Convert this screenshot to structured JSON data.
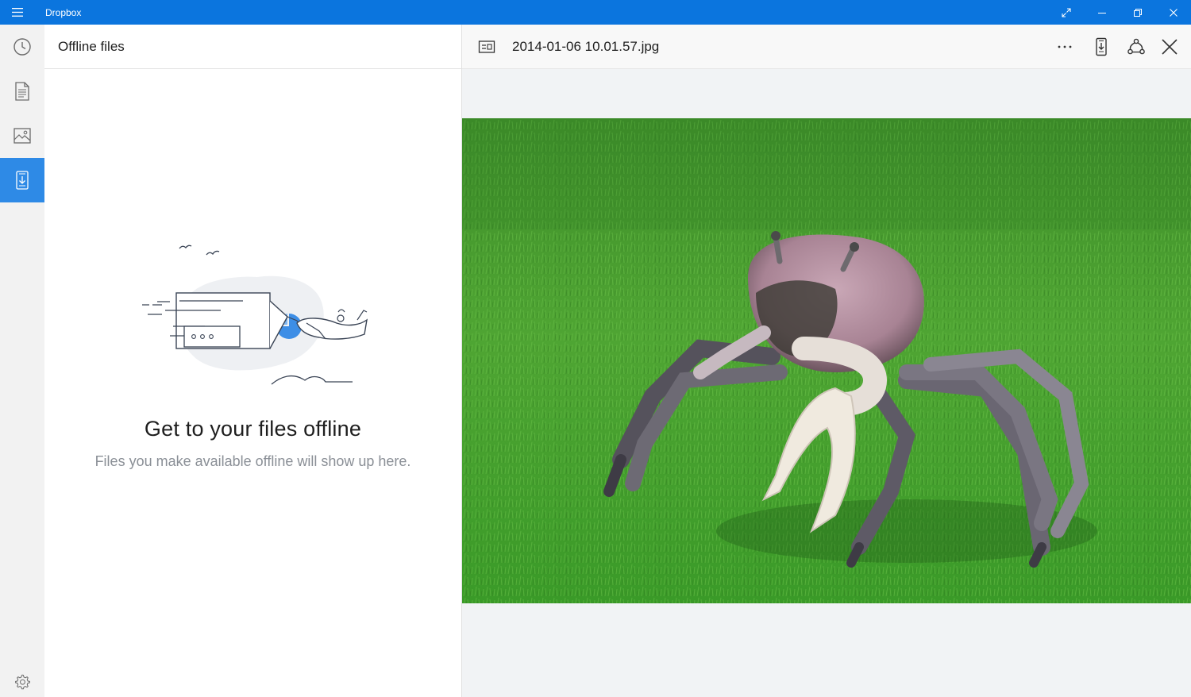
{
  "window": {
    "title": "Dropbox"
  },
  "sidebar": {
    "items": [
      {
        "icon": "clock-icon",
        "label": "Recents"
      },
      {
        "icon": "document-icon",
        "label": "Files"
      },
      {
        "icon": "photo-icon",
        "label": "Photos"
      },
      {
        "icon": "offline-device-icon",
        "label": "Offline files",
        "active": true
      }
    ],
    "settings_icon": "gear-icon"
  },
  "list": {
    "title": "Offline files",
    "empty_title": "Get to your files offline",
    "empty_subtitle": "Files you make available offline will show up here."
  },
  "preview": {
    "file_name": "2014-01-06 10.01.57.jpg",
    "toolbar_icons": [
      "more-icon",
      "make-offline-icon",
      "share-icon",
      "close-icon"
    ]
  },
  "colors": {
    "titlebar": "#0b75de",
    "active_rail": "#2e8ae6",
    "accent_blue": "#3d8ee6"
  }
}
